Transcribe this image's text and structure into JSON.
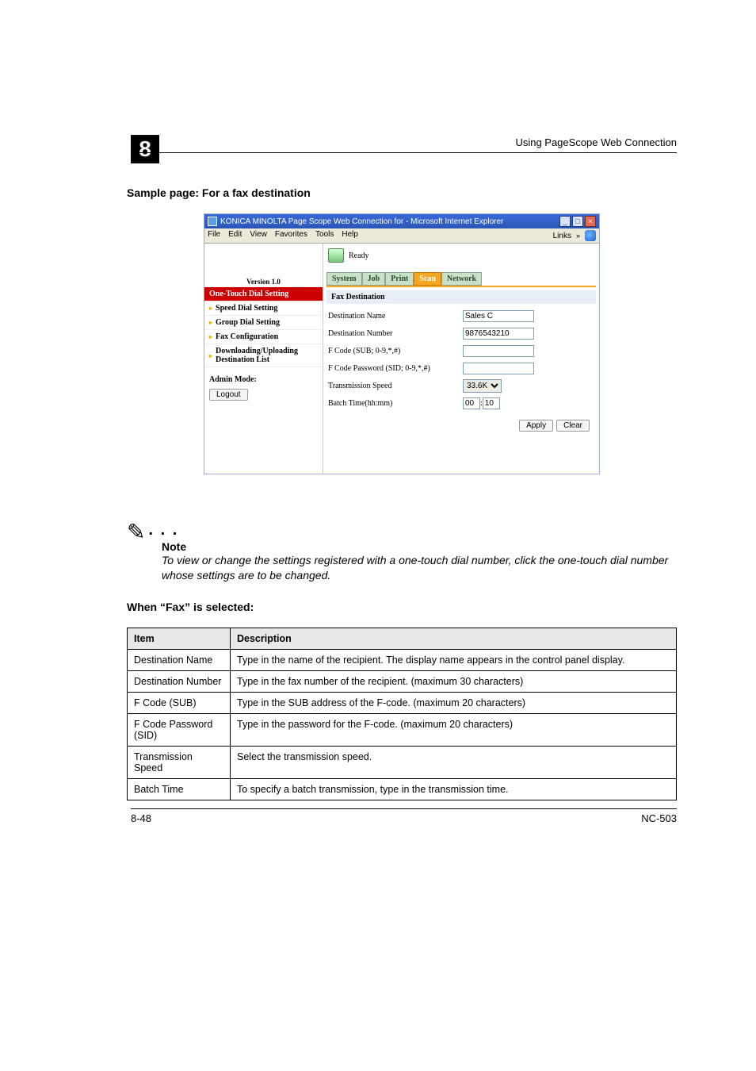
{
  "header": {
    "chapter": "8",
    "title": "Using PageScope Web Connection"
  },
  "subheading1": "Sample page: For a fax destination",
  "browser": {
    "title": "KONICA MINOLTA Page Scope Web Connection for       - Microsoft Internet Explorer",
    "menu": [
      "File",
      "Edit",
      "View",
      "Favorites",
      "Tools",
      "Help"
    ],
    "links": "Links",
    "version": "Version 1.0",
    "nav": {
      "selected": "One-Touch Dial Setting",
      "items": [
        "Speed Dial Setting",
        "Group Dial Setting",
        "Fax Configuration",
        "Downloading/Uploading Destination List"
      ]
    },
    "admin_mode": "Admin Mode:",
    "logout": "Logout",
    "status": "Ready",
    "tabs": [
      "System",
      "Job",
      "Print",
      "Scan",
      "Network"
    ],
    "panel_title": "Fax Destination",
    "fields": {
      "dest_name_lbl": "Destination Name",
      "dest_name_val": "Sales C",
      "dest_num_lbl": "Destination Number",
      "dest_num_val": "9876543210",
      "fcode_sub_lbl": "F Code (SUB; 0-9,*,#)",
      "fcode_pwd_lbl": "F Code Password (SID; 0-9,*,#)",
      "tx_speed_lbl": "Transmission Speed",
      "tx_speed_val": "33.6K",
      "batch_lbl": "Batch Time(hh:mm)",
      "batch_hh": "00",
      "batch_mm": "10"
    },
    "buttons": {
      "apply": "Apply",
      "clear": "Clear"
    }
  },
  "note": {
    "label": "Note",
    "text1": "To view or change the settings registered with a one-touch dial number, click the one-touch dial number whose settings are to be changed."
  },
  "subheading2": "When “Fax” is selected:",
  "table": {
    "head_item": "Item",
    "head_desc": "Description",
    "rows": [
      {
        "item": "Destination Name",
        "desc": "Type in the name of the recipient. The display name appears in the control panel display."
      },
      {
        "item": "Destination Number",
        "desc": "Type in the fax number of the recipient. (maximum 30 characters)"
      },
      {
        "item": "F Code (SUB)",
        "desc": "Type in the SUB address of the F-code. (maximum 20 characters)"
      },
      {
        "item": "F Code Password (SID)",
        "desc": "Type in the password for the F-code. (maximum 20 characters)"
      },
      {
        "item": "Transmission Speed",
        "desc": "Select the transmission speed."
      },
      {
        "item": "Batch Time",
        "desc": "To specify a batch transmission, type in the transmission time."
      }
    ]
  },
  "footer": {
    "left": "8-48",
    "right": "NC-503"
  }
}
